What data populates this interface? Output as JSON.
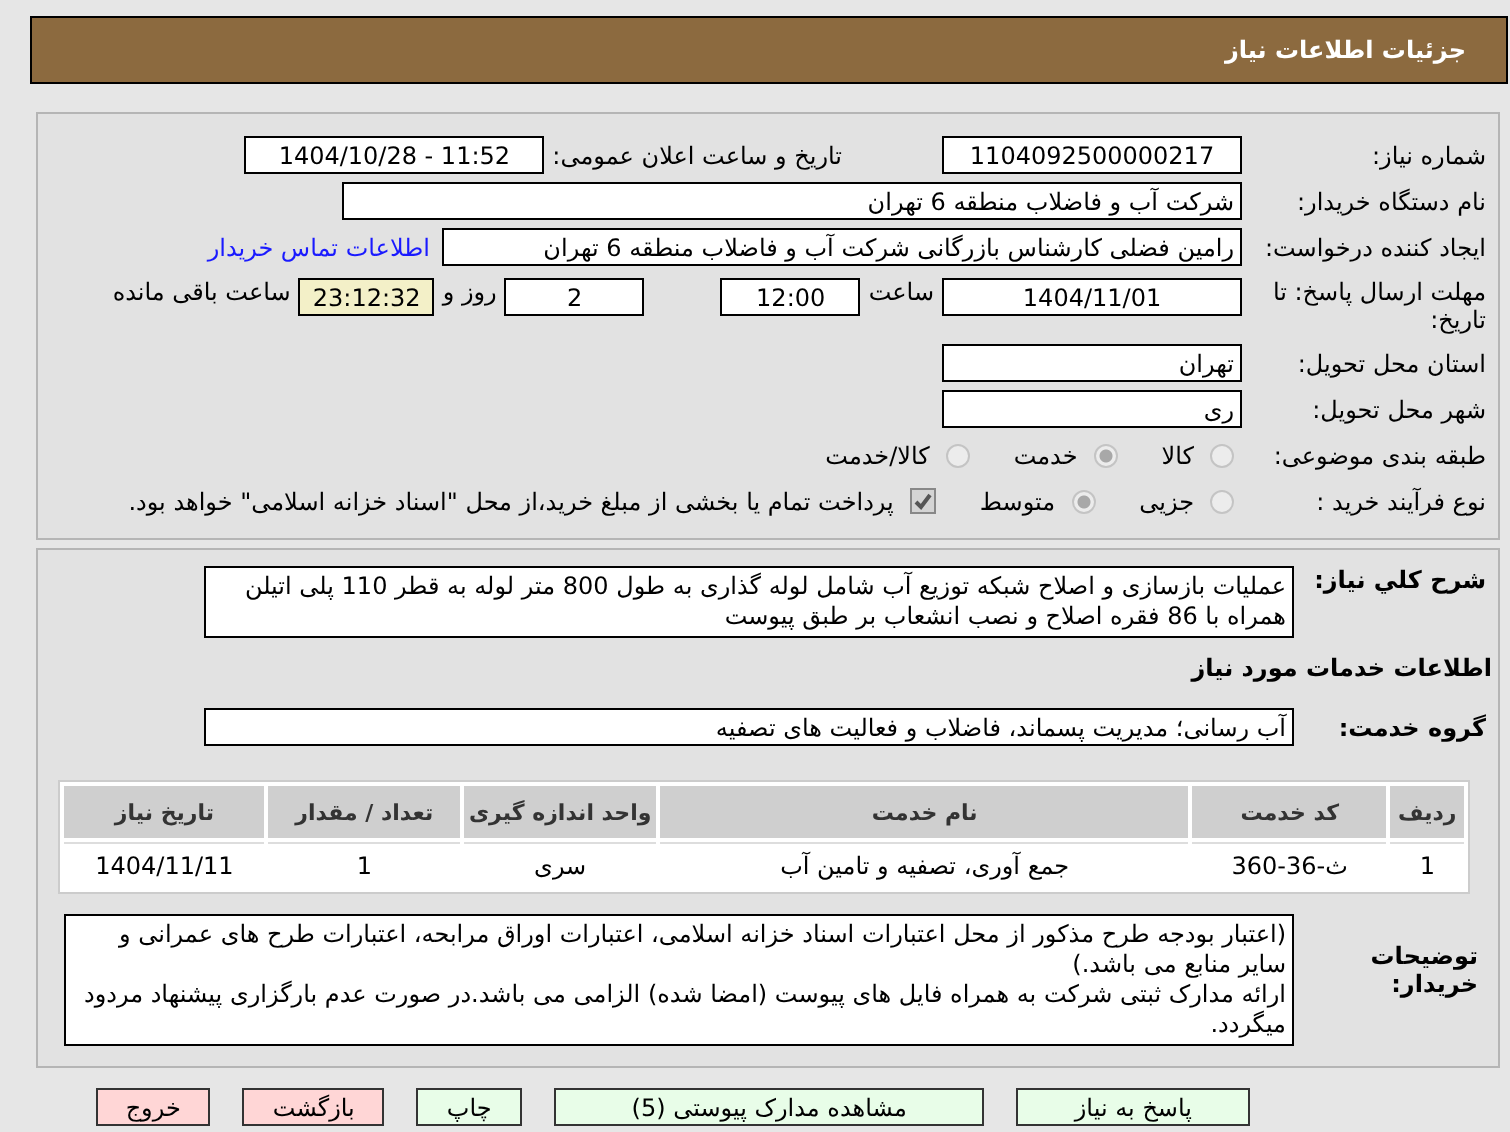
{
  "header": {
    "title": "جزئیات اطلاعات نیاز"
  },
  "need_number": {
    "label": "شماره نیاز:",
    "value": "1104092500000217"
  },
  "announce": {
    "label": "تاریخ و ساعت اعلان عمومی:",
    "value": "1404/10/28 - 11:52"
  },
  "buyer": {
    "label": "نام دستگاه خریدار:",
    "value": "شرکت آب و فاضلاب منطقه 6 تهران"
  },
  "requester": {
    "label": "ایجاد کننده درخواست:",
    "value": "رامین  فضلی کارشناس بازرگانی شرکت آب و فاضلاب منطقه 6 تهران",
    "link": "اطلاعات تماس خریدار"
  },
  "deadline": {
    "label": "مهلت ارسال پاسخ: تا تاریخ:",
    "date": "1404/11/01",
    "time_label": "ساعت",
    "time": "12:00",
    "days": "2",
    "days_label": "روز و",
    "remaining": "23:12:32",
    "remaining_label": "ساعت باقی مانده"
  },
  "province": {
    "label": "استان محل تحویل:",
    "value": "تهران"
  },
  "city": {
    "label": "شهر محل تحویل:",
    "value": "ری"
  },
  "category": {
    "label": "طبقه بندی موضوعی:",
    "options": [
      {
        "label": "کالا",
        "selected": false
      },
      {
        "label": "خدمت",
        "selected": true
      },
      {
        "label": "کالا/خدمت",
        "selected": false
      }
    ]
  },
  "process": {
    "label": "نوع فرآیند خرید :",
    "options": [
      {
        "label": "جزیی",
        "selected": false
      },
      {
        "label": "متوسط",
        "selected": true
      }
    ],
    "payment": {
      "checked": true,
      "label": "پرداخت تمام یا بخشی از مبلغ خرید،از محل \"اسناد خزانه اسلامی\" خواهد بود."
    }
  },
  "description": {
    "label": "شرح کلي نياز:",
    "value": "عملیات بازسازی و اصلاح شبکه توزیع آب شامل لوله گذاری به طول 800 متر لوله به قطر 110 پلی اتیلن همراه با 86 فقره اصلاح و نصب انشعاب بر طبق پیوست"
  },
  "services_title": "اطلاعات خدمات مورد نياز",
  "service_group": {
    "label": "گروه خدمت:",
    "value": "آب رسانی؛ مدیریت پسماند، فاضلاب و فعالیت های تصفیه"
  },
  "table": {
    "columns": [
      "ردیف",
      "کد خدمت",
      "نام خدمت",
      "واحد اندازه گیری",
      "تعداد / مقدار",
      "تاریخ نیاز"
    ],
    "rows": [
      [
        "1",
        "ث-36-360",
        "جمع آوری، تصفیه و تامین آب",
        "سری",
        "1",
        "1404/11/11"
      ]
    ]
  },
  "notes": {
    "label": "توضیحات خریدار:",
    "value": "(اعتبار بودجه طرح مذکور از محل اعتبارات اسناد خزانه اسلامی، اعتبارات اوراق مرابحه، اعتبارات طرح های عمرانی و سایر منابع می باشد.)\nارائه مدارک ثبتی شرکت به همراه فایل های پیوست (امضا شده) الزامی می باشد.در صورت عدم بارگزاری پیشنهاد مردود میگردد."
  },
  "buttons": [
    {
      "label": "پاسخ به نیاز",
      "color": "#e8fde8"
    },
    {
      "label": "مشاهده مدارک پیوستی (5)",
      "color": "#e8fde8"
    },
    {
      "label": "چاپ",
      "color": "#e8fde8"
    },
    {
      "label": "بازگشت",
      "color": "#ffd6d6"
    },
    {
      "label": "خروج",
      "color": "#ffd6d6"
    }
  ]
}
